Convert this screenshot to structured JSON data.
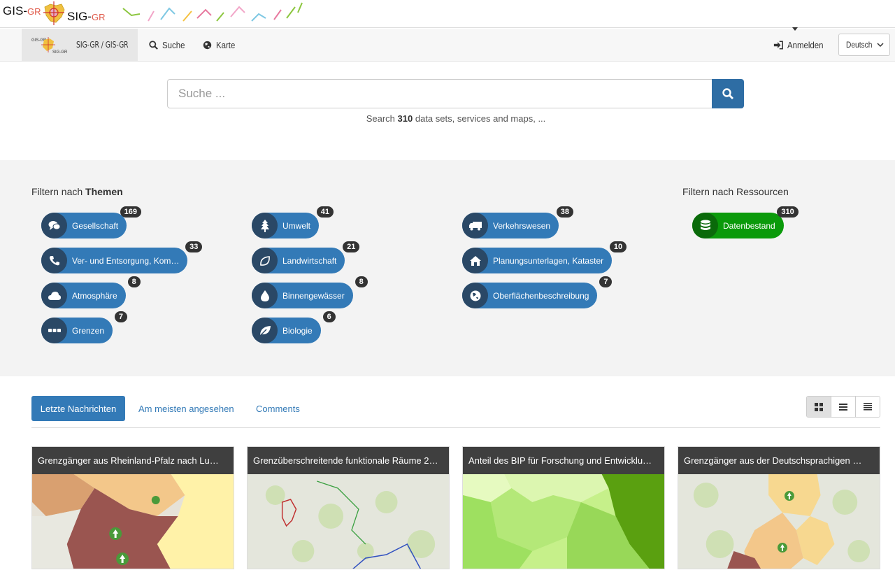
{
  "banner": {
    "logo_gis": "GIS-",
    "logo_gis_suffix": "GR",
    "logo_sig": "SIG-",
    "logo_sig_suffix": "GR"
  },
  "nav": {
    "brand": "SIG-GR / GIS-GR",
    "search": "Suche",
    "map": "Karte",
    "login": "Anmelden",
    "language": "Deutsch"
  },
  "search": {
    "placeholder": "Suche ...",
    "hint_prefix": "Search",
    "hint_count": "310",
    "hint_suffix": "data sets, services and maps, ..."
  },
  "filters": {
    "themes_prefix": "Filtern nach",
    "themes_bold": "Themen",
    "resources_title": "Filtern nach Ressourcen",
    "topics": [
      {
        "label": "Gesellschaft",
        "count": "169"
      },
      {
        "label": "Ver- und Entsorgung, Kom…",
        "count": "33"
      },
      {
        "label": "Atmosphäre",
        "count": "8"
      },
      {
        "label": "Grenzen",
        "count": "7"
      },
      {
        "label": "Umwelt",
        "count": "41"
      },
      {
        "label": "Landwirtschaft",
        "count": "21"
      },
      {
        "label": "Binnengewässer",
        "count": "8"
      },
      {
        "label": "Biologie",
        "count": "6"
      },
      {
        "label": "Verkehrswesen",
        "count": "38"
      },
      {
        "label": "Planungsunterlagen, Kataster",
        "count": "10"
      },
      {
        "label": "Oberflächenbeschreibung",
        "count": "7"
      }
    ],
    "resources": [
      {
        "label": "Datenbestand",
        "count": "310"
      }
    ]
  },
  "tabs": {
    "latest": "Letzte Nachrichten",
    "most_viewed": "Am meisten angesehen",
    "comments": "Comments"
  },
  "cards": [
    {
      "title": "Grenzgänger aus Rheinland-Pfalz nach Lu…"
    },
    {
      "title": "Grenzüberschreitende funktionale Räume 2…"
    },
    {
      "title": "Anteil des BIP für Forschung und Entwicklu…"
    },
    {
      "title": "Grenzgänger aus der Deutschsprachigen …"
    }
  ],
  "colors": {
    "primary": "#337ab7",
    "chip_icon": "#2a4866",
    "resource_green": "#0a9a0a",
    "card_title_bg": "#3f3f3f"
  }
}
